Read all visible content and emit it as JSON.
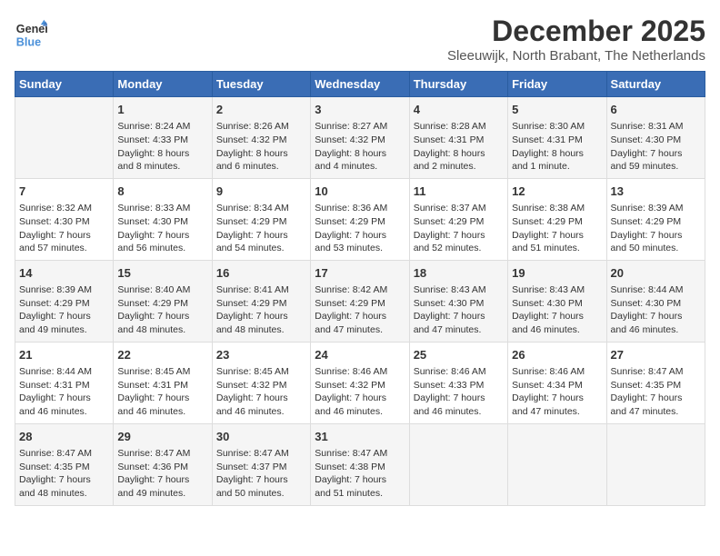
{
  "logo": {
    "line1": "General",
    "line2": "Blue"
  },
  "title": "December 2025",
  "location": "Sleeuwijk, North Brabant, The Netherlands",
  "days_header": [
    "Sunday",
    "Monday",
    "Tuesday",
    "Wednesday",
    "Thursday",
    "Friday",
    "Saturday"
  ],
  "weeks": [
    [
      {
        "day": "",
        "info": ""
      },
      {
        "day": "1",
        "info": "Sunrise: 8:24 AM\nSunset: 4:33 PM\nDaylight: 8 hours\nand 8 minutes."
      },
      {
        "day": "2",
        "info": "Sunrise: 8:26 AM\nSunset: 4:32 PM\nDaylight: 8 hours\nand 6 minutes."
      },
      {
        "day": "3",
        "info": "Sunrise: 8:27 AM\nSunset: 4:32 PM\nDaylight: 8 hours\nand 4 minutes."
      },
      {
        "day": "4",
        "info": "Sunrise: 8:28 AM\nSunset: 4:31 PM\nDaylight: 8 hours\nand 2 minutes."
      },
      {
        "day": "5",
        "info": "Sunrise: 8:30 AM\nSunset: 4:31 PM\nDaylight: 8 hours\nand 1 minute."
      },
      {
        "day": "6",
        "info": "Sunrise: 8:31 AM\nSunset: 4:30 PM\nDaylight: 7 hours\nand 59 minutes."
      }
    ],
    [
      {
        "day": "7",
        "info": "Sunrise: 8:32 AM\nSunset: 4:30 PM\nDaylight: 7 hours\nand 57 minutes."
      },
      {
        "day": "8",
        "info": "Sunrise: 8:33 AM\nSunset: 4:30 PM\nDaylight: 7 hours\nand 56 minutes."
      },
      {
        "day": "9",
        "info": "Sunrise: 8:34 AM\nSunset: 4:29 PM\nDaylight: 7 hours\nand 54 minutes."
      },
      {
        "day": "10",
        "info": "Sunrise: 8:36 AM\nSunset: 4:29 PM\nDaylight: 7 hours\nand 53 minutes."
      },
      {
        "day": "11",
        "info": "Sunrise: 8:37 AM\nSunset: 4:29 PM\nDaylight: 7 hours\nand 52 minutes."
      },
      {
        "day": "12",
        "info": "Sunrise: 8:38 AM\nSunset: 4:29 PM\nDaylight: 7 hours\nand 51 minutes."
      },
      {
        "day": "13",
        "info": "Sunrise: 8:39 AM\nSunset: 4:29 PM\nDaylight: 7 hours\nand 50 minutes."
      }
    ],
    [
      {
        "day": "14",
        "info": "Sunrise: 8:39 AM\nSunset: 4:29 PM\nDaylight: 7 hours\nand 49 minutes."
      },
      {
        "day": "15",
        "info": "Sunrise: 8:40 AM\nSunset: 4:29 PM\nDaylight: 7 hours\nand 48 minutes."
      },
      {
        "day": "16",
        "info": "Sunrise: 8:41 AM\nSunset: 4:29 PM\nDaylight: 7 hours\nand 48 minutes."
      },
      {
        "day": "17",
        "info": "Sunrise: 8:42 AM\nSunset: 4:29 PM\nDaylight: 7 hours\nand 47 minutes."
      },
      {
        "day": "18",
        "info": "Sunrise: 8:43 AM\nSunset: 4:30 PM\nDaylight: 7 hours\nand 47 minutes."
      },
      {
        "day": "19",
        "info": "Sunrise: 8:43 AM\nSunset: 4:30 PM\nDaylight: 7 hours\nand 46 minutes."
      },
      {
        "day": "20",
        "info": "Sunrise: 8:44 AM\nSunset: 4:30 PM\nDaylight: 7 hours\nand 46 minutes."
      }
    ],
    [
      {
        "day": "21",
        "info": "Sunrise: 8:44 AM\nSunset: 4:31 PM\nDaylight: 7 hours\nand 46 minutes."
      },
      {
        "day": "22",
        "info": "Sunrise: 8:45 AM\nSunset: 4:31 PM\nDaylight: 7 hours\nand 46 minutes."
      },
      {
        "day": "23",
        "info": "Sunrise: 8:45 AM\nSunset: 4:32 PM\nDaylight: 7 hours\nand 46 minutes."
      },
      {
        "day": "24",
        "info": "Sunrise: 8:46 AM\nSunset: 4:32 PM\nDaylight: 7 hours\nand 46 minutes."
      },
      {
        "day": "25",
        "info": "Sunrise: 8:46 AM\nSunset: 4:33 PM\nDaylight: 7 hours\nand 46 minutes."
      },
      {
        "day": "26",
        "info": "Sunrise: 8:46 AM\nSunset: 4:34 PM\nDaylight: 7 hours\nand 47 minutes."
      },
      {
        "day": "27",
        "info": "Sunrise: 8:47 AM\nSunset: 4:35 PM\nDaylight: 7 hours\nand 47 minutes."
      }
    ],
    [
      {
        "day": "28",
        "info": "Sunrise: 8:47 AM\nSunset: 4:35 PM\nDaylight: 7 hours\nand 48 minutes."
      },
      {
        "day": "29",
        "info": "Sunrise: 8:47 AM\nSunset: 4:36 PM\nDaylight: 7 hours\nand 49 minutes."
      },
      {
        "day": "30",
        "info": "Sunrise: 8:47 AM\nSunset: 4:37 PM\nDaylight: 7 hours\nand 50 minutes."
      },
      {
        "day": "31",
        "info": "Sunrise: 8:47 AM\nSunset: 4:38 PM\nDaylight: 7 hours\nand 51 minutes."
      },
      {
        "day": "",
        "info": ""
      },
      {
        "day": "",
        "info": ""
      },
      {
        "day": "",
        "info": ""
      }
    ]
  ]
}
